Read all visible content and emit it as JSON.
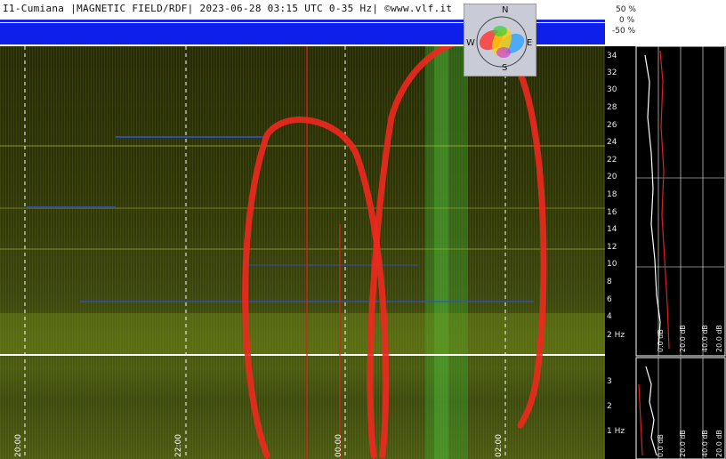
{
  "header": {
    "title": "I1-Cumiana |MAGNETIC FIELD/RDF| 2023-06-28 03:15 UTC 0-35 Hz| ©www.vlf.it"
  },
  "percent_scale": [
    "50 %",
    "0 %",
    "-50 %"
  ],
  "upper_hz_ticks": [
    "34",
    "32",
    "30",
    "28",
    "26",
    "24",
    "22",
    "20",
    "18",
    "16",
    "14",
    "12",
    "10",
    "8",
    "6",
    "4",
    "2 Hz"
  ],
  "lower_hz_ticks": [
    "3",
    "2",
    "1 Hz"
  ],
  "db_labels_upper": [
    "0.0 dB",
    "20.0 dB",
    "40.0 dB",
    "20.0 dB"
  ],
  "db_labels_lower": [
    "0.0 dB",
    "20.0 dB",
    "40.0 dB",
    "20.0 dB"
  ],
  "time_labels": [
    "20:00",
    "22:00",
    "00:00",
    "02:00"
  ],
  "compass": {
    "n": "N",
    "s": "S",
    "e": "E",
    "w": "W"
  },
  "colors": {
    "band_blue": "#0d1fe8",
    "spectrogram": "#3a4510",
    "annotation_red": "#f0281e",
    "trace_white": "#ffffff",
    "trace_red": "#e02020"
  }
}
